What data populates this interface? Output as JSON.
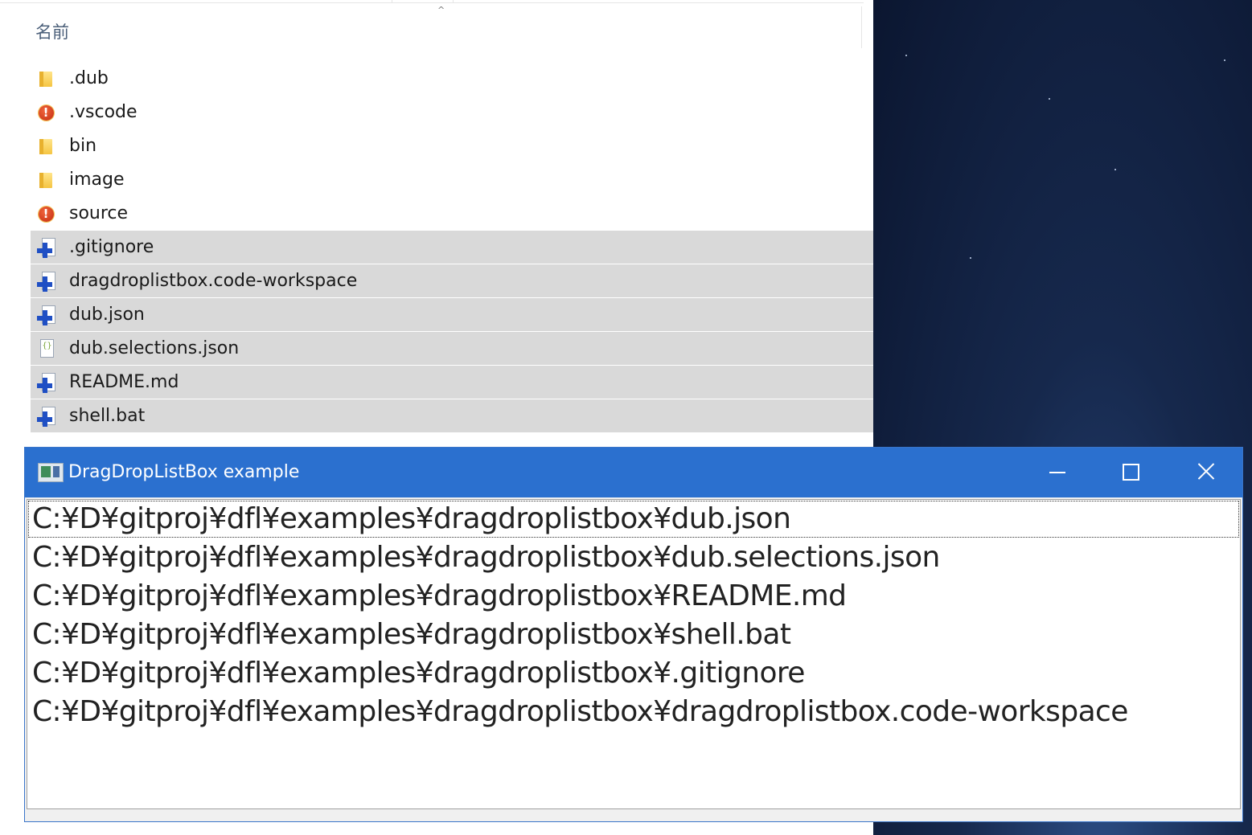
{
  "explorer": {
    "column_header": "名前",
    "sort_indicator": "^",
    "files": [
      {
        "name": ".dub",
        "icon": "folder-icon",
        "selected": false
      },
      {
        "name": ".vscode",
        "icon": "warning-icon",
        "selected": false
      },
      {
        "name": "bin",
        "icon": "folder-icon",
        "selected": false
      },
      {
        "name": "image",
        "icon": "folder-icon",
        "selected": false
      },
      {
        "name": "source",
        "icon": "warning-icon",
        "selected": false
      },
      {
        "name": ".gitignore",
        "icon": "file-plus-icon",
        "selected": true
      },
      {
        "name": "dragdroplistbox.code-workspace",
        "icon": "file-plus-icon",
        "selected": true
      },
      {
        "name": "dub.json",
        "icon": "file-plus-icon",
        "selected": true
      },
      {
        "name": "dub.selections.json",
        "icon": "json-file-icon",
        "selected": true
      },
      {
        "name": "README.md",
        "icon": "file-plus-icon",
        "selected": true
      },
      {
        "name": "shell.bat",
        "icon": "file-plus-icon",
        "selected": true
      }
    ]
  },
  "window": {
    "title": "DragDropListBox example",
    "accent_color": "#2b70cf",
    "controls": {
      "minimize": "minimize-icon",
      "maximize": "maximize-icon",
      "close": "close-icon"
    },
    "list_items": [
      "C:¥D¥gitproj¥dfl¥examples¥dragdroplistbox¥dub.json",
      "C:¥D¥gitproj¥dfl¥examples¥dragdroplistbox¥dub.selections.json",
      "C:¥D¥gitproj¥dfl¥examples¥dragdroplistbox¥README.md",
      "C:¥D¥gitproj¥dfl¥examples¥dragdroplistbox¥shell.bat",
      "C:¥D¥gitproj¥dfl¥examples¥dragdroplistbox¥.gitignore",
      "C:¥D¥gitproj¥dfl¥examples¥dragdroplistbox¥dragdroplistbox.code-workspace"
    ]
  }
}
